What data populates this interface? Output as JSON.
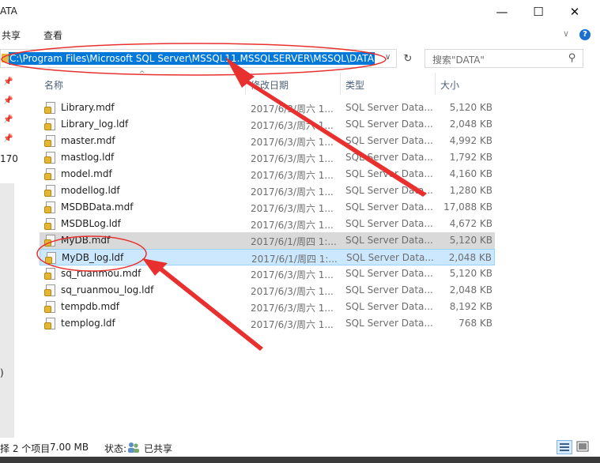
{
  "window": {
    "title": "ATA",
    "minimize": "—",
    "maximize": "☐",
    "close": "✕"
  },
  "ribbon": {
    "tabs": [
      "共享",
      "查看"
    ],
    "help": "?"
  },
  "address": {
    "path": "C:\\Program Files\\Microsoft SQL Server\\MSSQL11.MSSQLSERVER\\MSSQL\\DATA"
  },
  "search": {
    "placeholder": "搜索\"DATA\""
  },
  "nav": {
    "fragments": [
      "170",
      ")"
    ]
  },
  "columns": {
    "name": "名称",
    "date": "修改日期",
    "type": "类型",
    "size": "大小"
  },
  "files": [
    {
      "name": "Library.mdf",
      "date": "2017/6/3/周六 1...",
      "type": "SQL Server Data...",
      "size": "5,120 KB"
    },
    {
      "name": "Library_log.ldf",
      "date": "2017/6/3/周六 1...",
      "type": "SQL Server Data...",
      "size": "2,048 KB"
    },
    {
      "name": "master.mdf",
      "date": "2017/6/3/周六 1...",
      "type": "SQL Server Data...",
      "size": "4,992 KB"
    },
    {
      "name": "mastlog.ldf",
      "date": "2017/6/3/周六 1...",
      "type": "SQL Server Data...",
      "size": "1,792 KB"
    },
    {
      "name": "model.mdf",
      "date": "2017/6/3/周六 1...",
      "type": "SQL Server Data...",
      "size": "4,160 KB"
    },
    {
      "name": "modellog.ldf",
      "date": "2017/6/3/周六 1...",
      "type": "SQL Server Data...",
      "size": "1,280 KB"
    },
    {
      "name": "MSDBData.mdf",
      "date": "2017/6/3/周六 1...",
      "type": "SQL Server Data...",
      "size": "17,088 KB"
    },
    {
      "name": "MSDBLog.ldf",
      "date": "2017/6/3/周六 1...",
      "type": "SQL Server Data...",
      "size": "4,672 KB"
    },
    {
      "name": "MyDB.mdf",
      "date": "2017/6/1/周四 1:...",
      "type": "SQL Server Data...",
      "size": "5,120 KB"
    },
    {
      "name": "MyDB_log.ldf",
      "date": "2017/6/1/周四 1:...",
      "type": "SQL Server Data...",
      "size": "2,048 KB"
    },
    {
      "name": "sq_ruanmou.mdf",
      "date": "2017/6/3/周六 1...",
      "type": "SQL Server Data...",
      "size": "5,120 KB"
    },
    {
      "name": "sq_ruanmou_log.ldf",
      "date": "2017/6/3/周六 1...",
      "type": "SQL Server Data...",
      "size": "2,048 KB"
    },
    {
      "name": "tempdb.mdf",
      "date": "2017/6/3/周六 1...",
      "type": "SQL Server Data...",
      "size": "8,192 KB"
    },
    {
      "name": "templog.ldf",
      "date": "2017/6/3/周六 1...",
      "type": "SQL Server Data...",
      "size": "768 KB"
    }
  ],
  "status": {
    "count": "择 2 个项目",
    "size": "7.00 MB",
    "state_label": "状态:",
    "state_value": "已共享"
  },
  "colors": {
    "accent": "#0078d7",
    "selected_blue": "#cce8ff",
    "selected_gray": "#d9d9d9",
    "annotation": "#e8312f"
  },
  "icons": [
    "folder-icon",
    "refresh-icon",
    "search-icon",
    "pin-icon",
    "database-file-icon",
    "shared-users-icon",
    "details-view-icon",
    "large-icons-view-icon"
  ]
}
